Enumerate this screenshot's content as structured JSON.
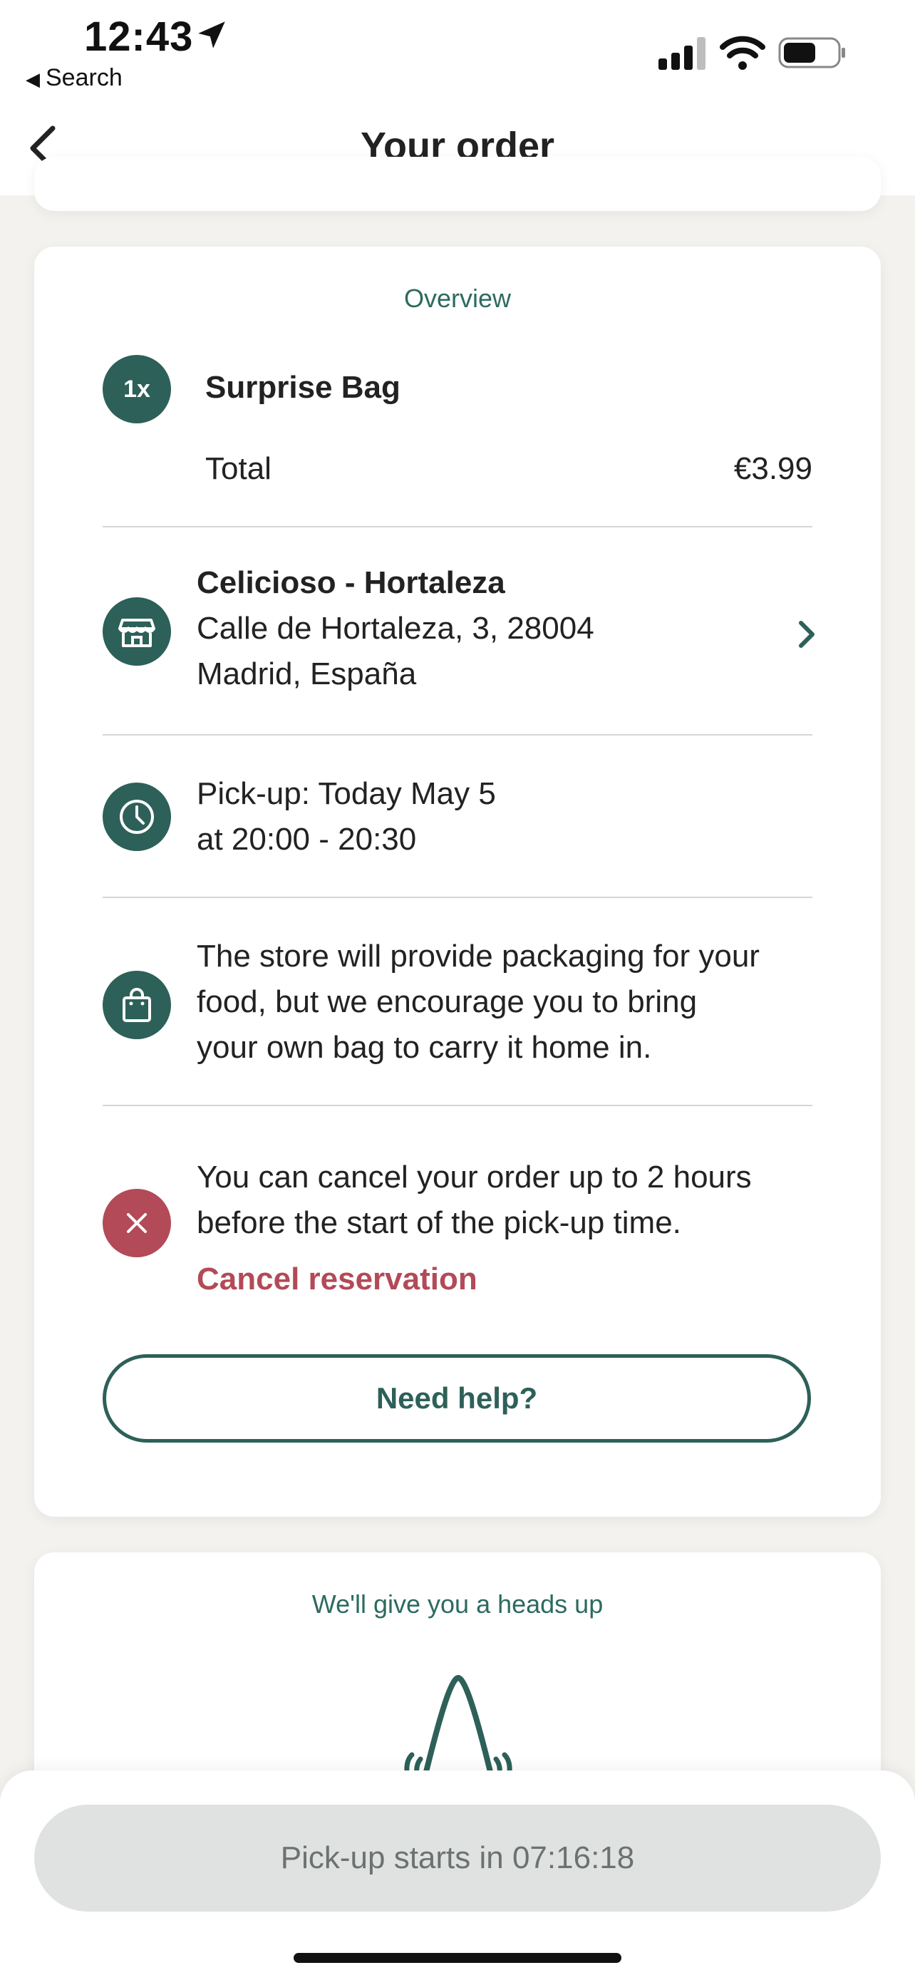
{
  "status_bar": {
    "time": "12:43",
    "back_app": "Search"
  },
  "header": {
    "title": "Your order"
  },
  "overview": {
    "section_title": "Overview",
    "quantity": "1x",
    "item_name": "Surprise Bag",
    "total_label": "Total",
    "total_value": "€3.99"
  },
  "store": {
    "name": "Celicioso - Hortaleza",
    "address_line1": "Calle de Hortaleza, 3, 28004",
    "address_line2": "Madrid, España"
  },
  "pickup": {
    "line1": "Pick-up: Today May 5",
    "line2": "at 20:00 - 20:30"
  },
  "packaging": {
    "line1": "The store will provide packaging for your",
    "line2": "food, but we encourage you to bring",
    "line3": "your own bag to carry it home in."
  },
  "cancel": {
    "line1": "You can cancel your order up to 2 hours",
    "line2": "before the start of the pick-up time.",
    "link_label": "Cancel reservation"
  },
  "help": {
    "button_label": "Need help?"
  },
  "notify": {
    "section_title": "We'll give you a heads up"
  },
  "bottom": {
    "pickup_countdown": "Pick-up starts in 07:16:18"
  },
  "colors": {
    "brand": "#2d6058",
    "cancel_red": "#b34a57",
    "background": "#f3f2ef"
  }
}
